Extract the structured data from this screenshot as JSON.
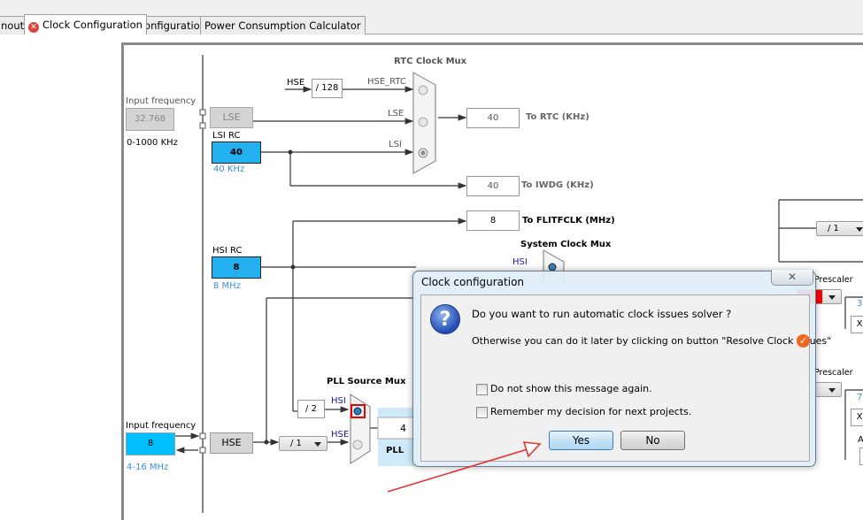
{
  "tabs": [
    {
      "label": "nout",
      "active": false
    },
    {
      "label": "Clock Configuration",
      "active": true,
      "icon": "error-icon"
    },
    {
      "label": "Configuration",
      "active": false
    },
    {
      "label": "Power Consumption Calculator",
      "active": false
    }
  ],
  "diagram": {
    "lse_input": {
      "label": "Input frequency",
      "value": "32.768",
      "range": "0-1000 KHz",
      "block": "LSE"
    },
    "lsi": {
      "label": "LSI RC",
      "value": "40",
      "freq": "40 KHz"
    },
    "hsi": {
      "label": "HSI RC",
      "value": "8",
      "freq": "8 MHz"
    },
    "hse_input": {
      "label": "Input frequency",
      "value": "8",
      "range": "4-16 MHz",
      "block": "HSE"
    },
    "rtc_mux": {
      "title": "RTC Clock Mux",
      "hse_label": "HSE",
      "divider": "/ 128",
      "inputs": [
        "HSE_RTC",
        "LSE",
        "LSI"
      ],
      "selected": "LSI"
    },
    "outputs": [
      {
        "value": "40",
        "label": "To RTC (KHz)"
      },
      {
        "value": "40",
        "label": "To IWDG (KHz)"
      },
      {
        "value": "8",
        "label": "To FLITFCLK (MHz)"
      }
    ],
    "system_clock_mux": {
      "title": "System Clock Mux",
      "inputs": [
        "HSI"
      ]
    },
    "pll_source_mux": {
      "title": "PLL Source Mux",
      "hsi_divider": "/ 2",
      "hse_prediv": "/ 1",
      "inputs": [
        "HSI",
        "HSE"
      ],
      "selected": "HSI"
    },
    "pll": {
      "label": "PLL",
      "value": "4"
    },
    "right_side": {
      "divider_top": "/ 1",
      "prescaler_label_1": "Prescaler",
      "prescaler_label_2": "Prescaler",
      "value_1": "3",
      "value_2": "7",
      "x_1": "X",
      "x_2": "X",
      "a_label": "A"
    }
  },
  "dialog": {
    "title": "Clock configuration",
    "close_label": "✕",
    "question": "Do you want to run automatic clock issues solver ?",
    "hint": "Otherwise you can do it later by clicking on button \"Resolve Clock Issues\"",
    "checkboxes": [
      {
        "label": "Do not show this message again.",
        "checked": false
      },
      {
        "label": "Remember my decision for next projects.",
        "checked": false
      }
    ],
    "yes_label": "Yes",
    "no_label": "No"
  },
  "annotation": {
    "arrow_color": "#e53333",
    "target": "yes-button"
  }
}
